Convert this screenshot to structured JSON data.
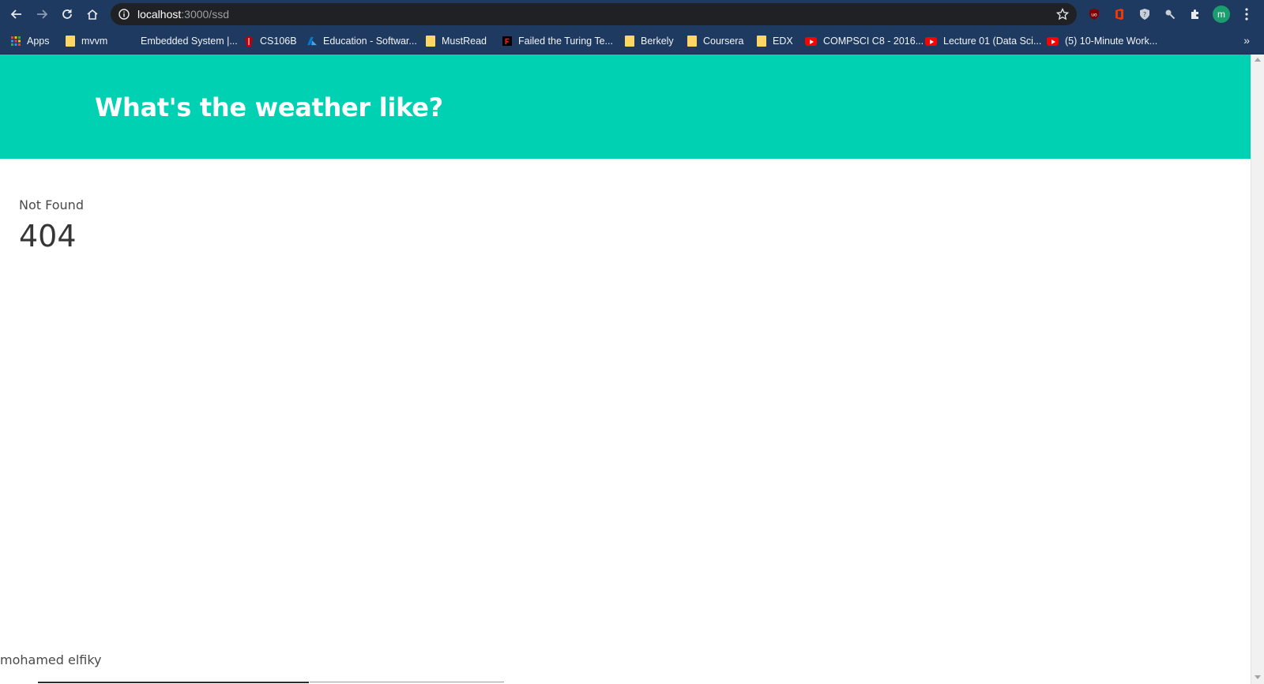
{
  "browser": {
    "url_host": "localhost",
    "url_path": ":3000/ssd",
    "avatar_initial": "m",
    "bookmarks": [
      {
        "label": "Apps",
        "icon": "apps-grid-icon"
      },
      {
        "label": "mvvm",
        "icon": "folder-icon"
      },
      {
        "label": "Embedded System |...",
        "icon": "blank-icon"
      },
      {
        "label": "CS106B",
        "icon": "stanford-icon"
      },
      {
        "label": "Education - Softwar...",
        "icon": "azure-icon"
      },
      {
        "label": "MustRead",
        "icon": "folder-icon"
      },
      {
        "label": "Failed the Turing Te...",
        "icon": "f-icon"
      },
      {
        "label": "Berkely",
        "icon": "folder-icon"
      },
      {
        "label": "Coursera",
        "icon": "folder-icon"
      },
      {
        "label": "EDX",
        "icon": "folder-icon"
      },
      {
        "label": "COMPSCI C8 - 2016...",
        "icon": "youtube-icon"
      },
      {
        "label": "Lecture 01 (Data Sci...",
        "icon": "youtube-icon"
      },
      {
        "label": "(5) 10-Minute Work...",
        "icon": "youtube-icon"
      }
    ],
    "overflow": "»"
  },
  "header": {
    "title": "What's the weather like?"
  },
  "main": {
    "message": "Not Found",
    "code": "404"
  },
  "footer": {
    "author": "mohamed elfiky"
  },
  "colors": {
    "header_bg": "#00d1b2",
    "chrome_bg": "#1e3a60"
  }
}
